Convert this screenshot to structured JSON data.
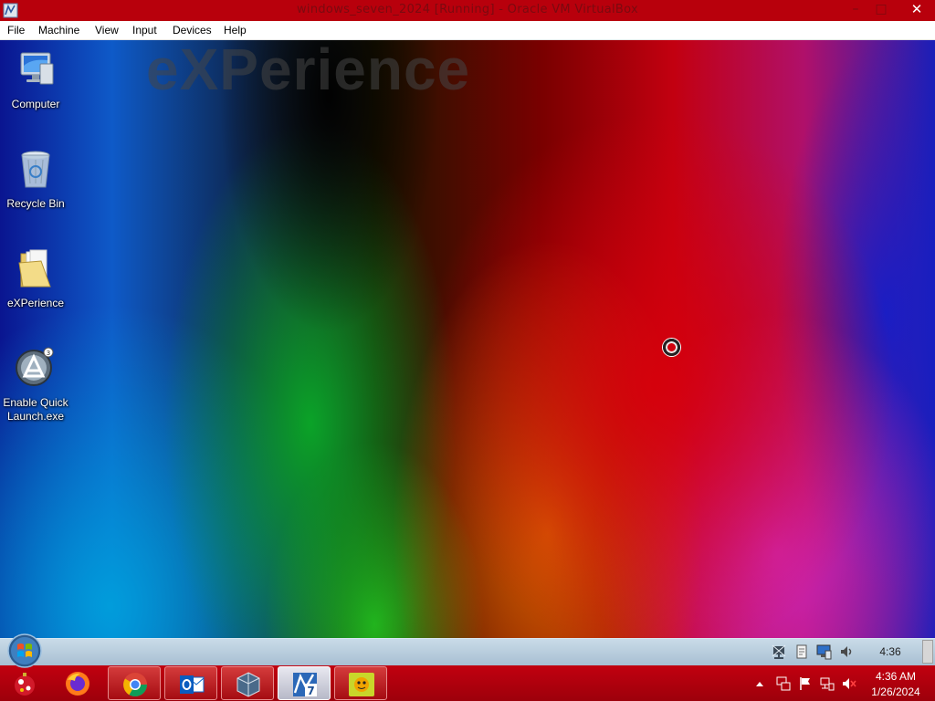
{
  "host_window": {
    "title": "windows_seven_2024 [Running] - Oracle VM VirtualBox",
    "controls": {
      "minimize": "–",
      "maximize": "□",
      "close": "✕"
    },
    "menu": [
      "File",
      "Machine",
      "View",
      "Input",
      "Devices",
      "Help"
    ]
  },
  "desktop": {
    "wallpaper_text": "eXPerience",
    "icons": [
      {
        "label": "Computer",
        "icon": "computer-icon"
      },
      {
        "label": "Recycle Bin",
        "icon": "recycle-bin-icon"
      },
      {
        "label": "eXPerience",
        "icon": "folder-icon"
      },
      {
        "label": "Enable Quick Launch.exe",
        "icon": "quick-launch-icon"
      }
    ]
  },
  "taskbar_upper": {
    "clock": "4:36",
    "tray_icons": [
      "network-icon",
      "clipboard-icon",
      "display-icon",
      "volume-icon"
    ]
  },
  "taskbar_lower": {
    "pinned": [
      {
        "name": "christmas-ornament-icon"
      },
      {
        "name": "firefox-icon"
      },
      {
        "name": "chrome-icon"
      },
      {
        "name": "outlook-icon"
      },
      {
        "name": "virtualbox-icon"
      },
      {
        "name": "windows-7-icon"
      },
      {
        "name": "yellow-app-icon"
      }
    ],
    "tray_icons": [
      "show-hidden-icons-icon",
      "network-adapter-icon",
      "action-center-flag-icon",
      "network-status-icon",
      "volume-muted-icon"
    ],
    "time": "4:36 AM",
    "date": "1/26/2024"
  },
  "colors": {
    "host_title_bg": "#b8000c",
    "taskbar_red": "#b0000d",
    "taskbar_upper": "#b9cddd"
  }
}
